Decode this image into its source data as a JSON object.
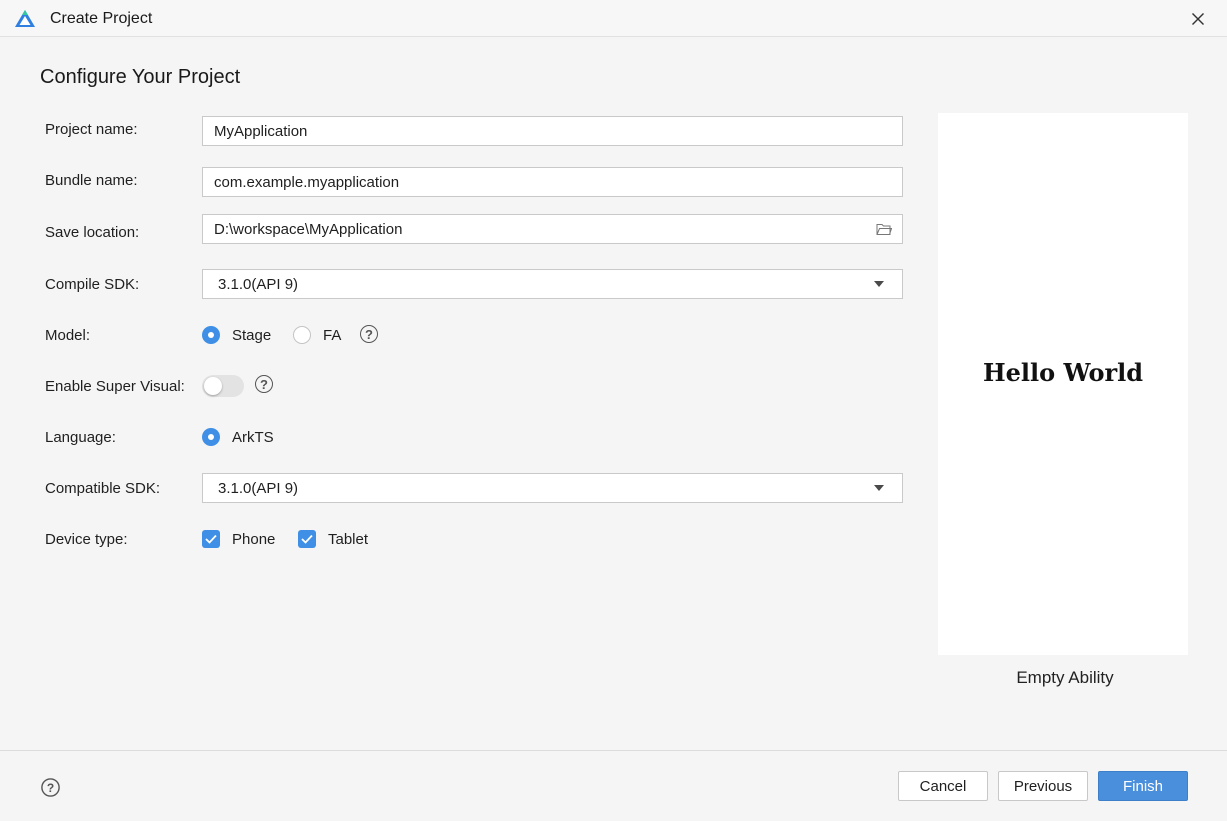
{
  "window": {
    "title": "Create Project",
    "logo_icon": "deveco-logo-icon",
    "close_icon": "close-icon"
  },
  "heading": "Configure Your Project",
  "fields": {
    "project_name": {
      "label": "Project name:",
      "value": "MyApplication"
    },
    "bundle_name": {
      "label": "Bundle name:",
      "value": "com.example.myapplication"
    },
    "save_location": {
      "label": "Save location:",
      "value": "D:\\workspace\\MyApplication",
      "icon": "folder-icon"
    },
    "compile_sdk": {
      "label": "Compile SDK:",
      "value": "3.1.0(API 9)"
    },
    "model": {
      "label": "Model:",
      "options": [
        "Stage",
        "FA"
      ],
      "selected": "Stage"
    },
    "super_visual": {
      "label": "Enable Super Visual:",
      "enabled": false
    },
    "language": {
      "label": "Language:",
      "options": [
        "ArkTS"
      ],
      "selected": "ArkTS"
    },
    "compatible_sdk": {
      "label": "Compatible SDK:",
      "value": "3.1.0(API 9)"
    },
    "device_type": {
      "label": "Device type:",
      "options": [
        "Phone",
        "Tablet"
      ],
      "checked": [
        "Phone",
        "Tablet"
      ]
    }
  },
  "preview": {
    "text": "Hello World",
    "template_name": "Empty Ability"
  },
  "footer": {
    "help_icon": "help-icon",
    "cancel": "Cancel",
    "previous": "Previous",
    "finish": "Finish"
  },
  "colors": {
    "accent": "#3e8fe5",
    "primary_button": "#4a8fdb",
    "background": "#f5f5f5"
  }
}
